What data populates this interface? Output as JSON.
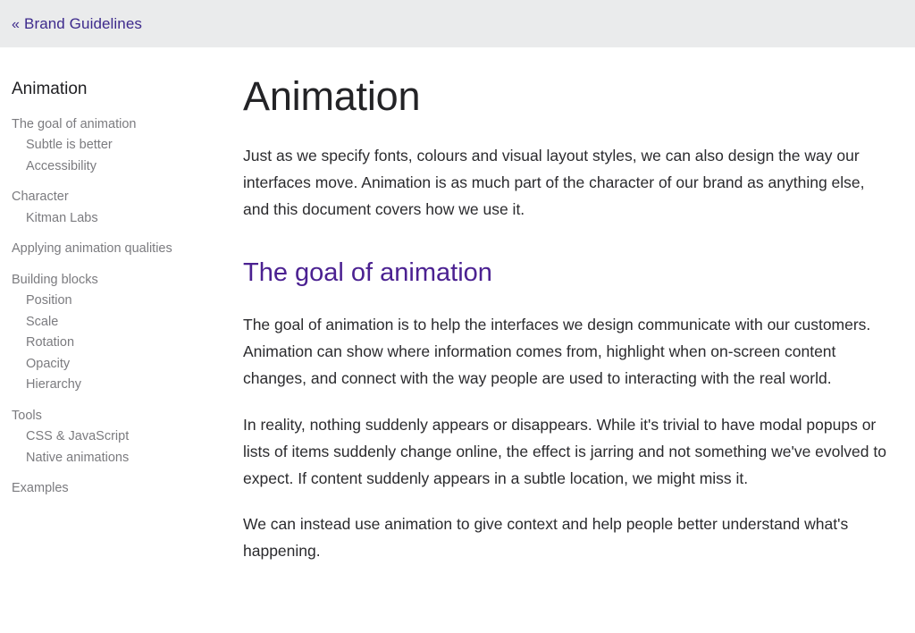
{
  "topbar": {
    "back_glyph": "«",
    "back_label": "Brand Guidelines"
  },
  "sidebar": {
    "title": "Animation",
    "groups": [
      {
        "items": [
          {
            "label": "The goal of animation",
            "level": 1
          },
          {
            "label": "Subtle is better",
            "level": 2
          },
          {
            "label": "Accessibility",
            "level": 2
          }
        ]
      },
      {
        "items": [
          {
            "label": "Character",
            "level": 1
          },
          {
            "label": "Kitman Labs",
            "level": 2
          }
        ]
      },
      {
        "items": [
          {
            "label": "Applying animation qualities",
            "level": 1
          }
        ]
      },
      {
        "items": [
          {
            "label": "Building blocks",
            "level": 1
          },
          {
            "label": "Position",
            "level": 2
          },
          {
            "label": "Scale",
            "level": 2
          },
          {
            "label": "Rotation",
            "level": 2
          },
          {
            "label": "Opacity",
            "level": 2
          },
          {
            "label": "Hierarchy",
            "level": 2
          }
        ]
      },
      {
        "items": [
          {
            "label": "Tools",
            "level": 1
          },
          {
            "label": "CSS & JavaScript",
            "level": 2
          },
          {
            "label": "Native animations",
            "level": 2
          }
        ]
      },
      {
        "items": [
          {
            "label": "Examples",
            "level": 1
          }
        ]
      }
    ]
  },
  "main": {
    "title": "Animation",
    "intro_paragraph": "Just as we specify fonts, colours and visual layout styles, we can also design the way our interfaces move. Animation is as much part of the character of our brand as anything else, and this document covers how we use it.",
    "section_heading": "The goal of animation",
    "paragraphs": [
      "The goal of animation is to help the interfaces we design communicate with our customers. Animation can show where information comes from, highlight when on-screen content changes, and connect with the way people are used to interacting with the real world.",
      "In reality, nothing suddenly appears or disappears. While it's trivial to have modal popups or lists of items suddenly change online, the effect is jarring and not something we've evolved to expect. If content suddenly appears in a subtle location, we might miss it.",
      "We can instead use animation to give context and help people better understand what's happening."
    ]
  },
  "colors": {
    "topbar_background": "#eaebec",
    "link_purple": "#3d2a8c",
    "heading_purple": "#4b2191",
    "body_text": "#2b2b2e",
    "nav_text": "#7b7b7f",
    "page_background": "#ffffff"
  }
}
